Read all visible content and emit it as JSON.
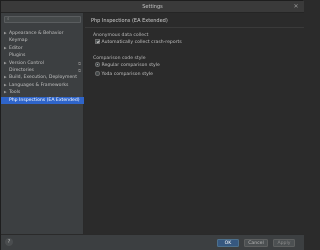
{
  "window": {
    "title": "Settings",
    "close_glyph": "✕"
  },
  "sidebar": {
    "search": {
      "value": "",
      "placeholder": ""
    },
    "items": [
      {
        "label": "Appearance & Behavior",
        "expandable": true,
        "copy": false
      },
      {
        "label": "Keymap",
        "expandable": false,
        "copy": false
      },
      {
        "label": "Editor",
        "expandable": true,
        "copy": false
      },
      {
        "label": "Plugins",
        "expandable": false,
        "copy": false
      },
      {
        "label": "Version Control",
        "expandable": true,
        "copy": true
      },
      {
        "label": "Directories",
        "expandable": false,
        "copy": true
      },
      {
        "label": "Build, Execution, Deployment",
        "expandable": true,
        "copy": false
      },
      {
        "label": "Languages & Frameworks",
        "expandable": true,
        "copy": false
      },
      {
        "label": "Tools",
        "expandable": true,
        "copy": false
      },
      {
        "label": "Php Inspections (EA Extended)",
        "expandable": false,
        "copy": false,
        "selected": true
      }
    ]
  },
  "content": {
    "title": "Php Inspections (EA Extended)",
    "groups": {
      "anonymous": {
        "title": "Anonymous data collect",
        "checkbox_label": "Automatically collect crash-reports",
        "checked": true
      },
      "comparison": {
        "title": "Comparison code style",
        "options": [
          {
            "label": "Regular comparison style",
            "selected": true
          },
          {
            "label": "Yoda comparison style",
            "selected": false
          }
        ]
      }
    }
  },
  "footer": {
    "help_label": "?",
    "ok_label": "OK",
    "cancel_label": "Cancel",
    "apply_label": "Apply"
  },
  "colors": {
    "selection": "#2f65ca",
    "primary_button": "#365880"
  }
}
